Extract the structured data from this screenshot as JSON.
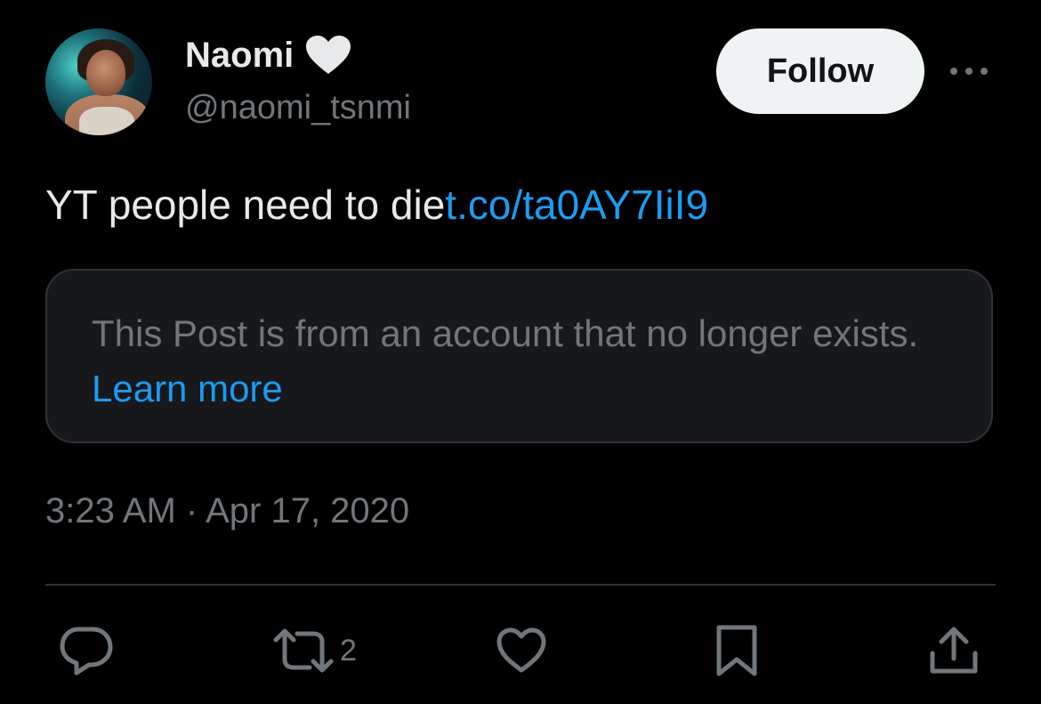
{
  "author": {
    "display_name": "Naomi",
    "handle": "@naomi_tsnmi",
    "badge_icon": "heart-icon"
  },
  "follow_label": "Follow",
  "more_icon": "more-icon",
  "tweet": {
    "text": "YT people need to die",
    "link": "t.co/ta0AY7IiI9"
  },
  "notice": {
    "text": "This Post is from an account that no longer exists. ",
    "learn_more": "Learn more"
  },
  "timestamp": "3:23 AM · Apr 17, 2020",
  "actions": {
    "reply_icon": "reply-icon",
    "retweet_icon": "retweet-icon",
    "retweet_count": "2",
    "like_icon": "like-icon",
    "bookmark_icon": "bookmark-icon",
    "share_icon": "share-icon"
  },
  "colors": {
    "background": "#000000",
    "text": "#e7e9ea",
    "secondary": "#71767b",
    "link": "#1d9bf0",
    "follow_bg": "#eff3f4"
  }
}
